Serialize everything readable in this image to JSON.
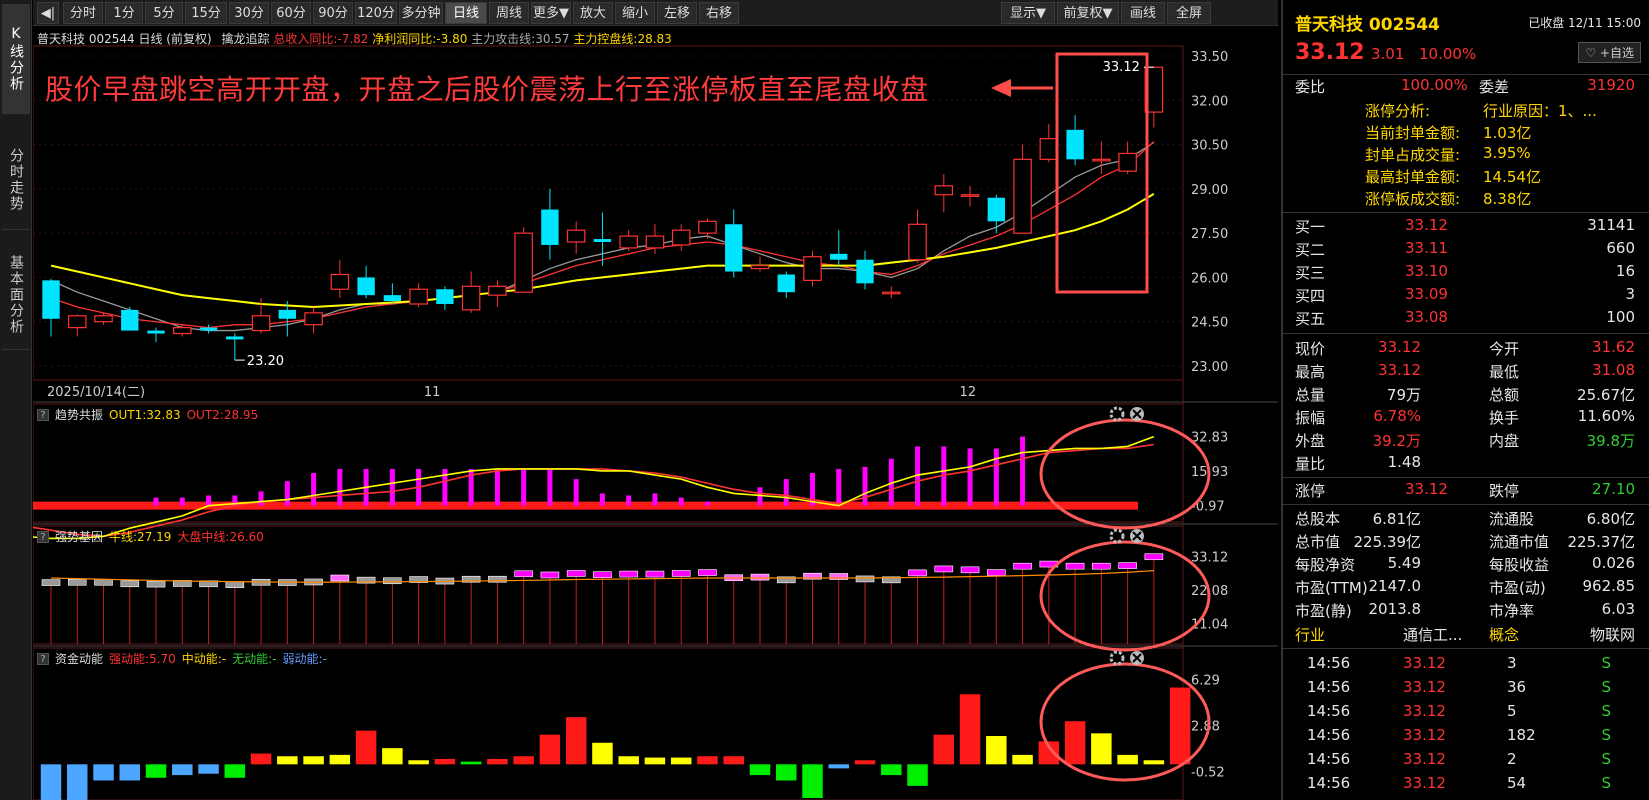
{
  "left_tabs": [
    "K线分析",
    "分时走势",
    "基本面分析"
  ],
  "toolbar": {
    "collapse": "◀|",
    "items": [
      "分时",
      "1分",
      "5分",
      "15分",
      "30分",
      "60分",
      "90分",
      "120分",
      "多分钟",
      "日线",
      "周线",
      "更多▼",
      "放大",
      "缩小",
      "左移",
      "右移"
    ],
    "active": "日线",
    "right": [
      "显示▼",
      "前复权▼",
      "画线",
      "全屏"
    ]
  },
  "chart_info": {
    "stock_tag": "普天科技 002544 日线",
    "fq": "(前复权)",
    "indicator": "擒龙追踪",
    "rev": "总收入同比:-7.82",
    "profit": "净利润同比:-3.80",
    "attack": "主力攻击线:30.57",
    "control": "主力控盘线:28.83"
  },
  "annotation": "股价早盘跳空高开开盘，开盘之后股价震荡上行至涨停板直至尾盘收盘",
  "chart_data": [
    {
      "type": "candlestick",
      "y_ticks": [
        "33.50",
        "32.00",
        "30.50",
        "29.00",
        "27.50",
        "26.00",
        "24.50",
        "23.00"
      ],
      "ylim": [
        23.0,
        33.5
      ],
      "x_labels": [
        "2025/10/14(二)",
        "11",
        "12"
      ],
      "low_label": "23.20",
      "high_label": "33.12",
      "candles": [
        {
          "o": 25.9,
          "c": 24.6,
          "h": 25.95,
          "l": 24.0
        },
        {
          "o": 24.3,
          "c": 24.7,
          "h": 24.75,
          "l": 24.0
        },
        {
          "o": 24.5,
          "c": 24.7,
          "h": 24.8,
          "l": 24.4
        },
        {
          "o": 24.9,
          "c": 24.2,
          "h": 25.0,
          "l": 24.2
        },
        {
          "o": 24.2,
          "c": 24.1,
          "h": 24.3,
          "l": 23.8
        },
        {
          "o": 24.1,
          "c": 24.3,
          "h": 24.4,
          "l": 24.0
        },
        {
          "o": 24.3,
          "c": 24.2,
          "h": 24.4,
          "l": 24.1
        },
        {
          "o": 24.0,
          "c": 23.9,
          "h": 24.1,
          "l": 23.2
        },
        {
          "o": 24.2,
          "c": 24.7,
          "h": 25.3,
          "l": 24.1
        },
        {
          "o": 24.9,
          "c": 24.6,
          "h": 25.2,
          "l": 24.0
        },
        {
          "o": 24.4,
          "c": 24.8,
          "h": 25.0,
          "l": 24.1
        },
        {
          "o": 25.6,
          "c": 26.1,
          "h": 26.6,
          "l": 25.3
        },
        {
          "o": 26.0,
          "c": 25.4,
          "h": 26.4,
          "l": 25.3
        },
        {
          "o": 25.4,
          "c": 25.2,
          "h": 25.8,
          "l": 25.1
        },
        {
          "o": 25.1,
          "c": 25.6,
          "h": 25.8,
          "l": 25.0
        },
        {
          "o": 25.6,
          "c": 25.1,
          "h": 25.7,
          "l": 24.9
        },
        {
          "o": 24.9,
          "c": 25.7,
          "h": 26.2,
          "l": 24.8
        },
        {
          "o": 25.4,
          "c": 25.7,
          "h": 25.9,
          "l": 25.0
        },
        {
          "o": 25.5,
          "c": 27.5,
          "h": 27.7,
          "l": 25.5
        },
        {
          "o": 28.3,
          "c": 27.1,
          "h": 29.0,
          "l": 26.6
        },
        {
          "o": 27.2,
          "c": 27.6,
          "h": 27.9,
          "l": 26.8
        },
        {
          "o": 27.3,
          "c": 27.2,
          "h": 28.2,
          "l": 26.4
        },
        {
          "o": 27.0,
          "c": 27.4,
          "h": 27.6,
          "l": 26.9
        },
        {
          "o": 27.0,
          "c": 27.4,
          "h": 27.8,
          "l": 26.8
        },
        {
          "o": 27.1,
          "c": 27.6,
          "h": 27.8,
          "l": 26.9
        },
        {
          "o": 27.5,
          "c": 27.9,
          "h": 28.0,
          "l": 27.3
        },
        {
          "o": 27.8,
          "c": 26.2,
          "h": 28.3,
          "l": 26.0
        },
        {
          "o": 26.3,
          "c": 26.4,
          "h": 26.7,
          "l": 26.2
        },
        {
          "o": 26.1,
          "c": 25.5,
          "h": 26.2,
          "l": 25.3
        },
        {
          "o": 25.9,
          "c": 26.7,
          "h": 26.9,
          "l": 25.7
        },
        {
          "o": 26.8,
          "c": 26.6,
          "h": 27.6,
          "l": 26.4
        },
        {
          "o": 26.6,
          "c": 25.8,
          "h": 26.9,
          "l": 25.6
        },
        {
          "o": 25.5,
          "c": 25.5,
          "h": 25.7,
          "l": 25.3
        },
        {
          "o": 26.6,
          "c": 27.8,
          "h": 28.3,
          "l": 26.5
        },
        {
          "o": 28.8,
          "c": 29.1,
          "h": 29.5,
          "l": 28.2
        },
        {
          "o": 28.8,
          "c": 28.8,
          "h": 29.1,
          "l": 28.4
        },
        {
          "o": 28.7,
          "c": 27.9,
          "h": 28.8,
          "l": 27.5
        },
        {
          "o": 27.5,
          "c": 30.0,
          "h": 30.5,
          "l": 27.5
        },
        {
          "o": 30.0,
          "c": 30.7,
          "h": 31.2,
          "l": 29.9
        },
        {
          "o": 31.0,
          "c": 30.0,
          "h": 31.5,
          "l": 29.8
        },
        {
          "o": 30.0,
          "c": 30.0,
          "h": 30.6,
          "l": 29.5
        },
        {
          "o": 29.6,
          "c": 30.2,
          "h": 30.6,
          "l": 29.5
        },
        {
          "o": 31.6,
          "c": 33.12,
          "h": 33.12,
          "l": 31.08
        }
      ],
      "ma_red": [
        25.3,
        25.0,
        24.8,
        24.6,
        24.5,
        24.4,
        24.3,
        24.4,
        24.4,
        24.5,
        24.6,
        24.8,
        25.0,
        25.1,
        25.2,
        25.3,
        25.4,
        25.5,
        25.8,
        26.1,
        26.4,
        26.6,
        26.8,
        27.0,
        27.1,
        27.2,
        27.1,
        26.9,
        26.7,
        26.5,
        26.4,
        26.2,
        26.1,
        26.4,
        26.8,
        27.1,
        27.4,
        27.8,
        28.3,
        28.8,
        29.4,
        29.8,
        30.6
      ],
      "ma_yellow": [
        26.4,
        26.2,
        26.0,
        25.8,
        25.6,
        25.4,
        25.3,
        25.2,
        25.1,
        25.05,
        25.0,
        25.05,
        25.1,
        25.15,
        25.2,
        25.3,
        25.4,
        25.5,
        25.6,
        25.75,
        25.9,
        26.0,
        26.1,
        26.2,
        26.3,
        26.4,
        26.4,
        26.4,
        26.4,
        26.4,
        26.4,
        26.4,
        26.5,
        26.6,
        26.7,
        26.85,
        27.0,
        27.2,
        27.4,
        27.6,
        27.9,
        28.3,
        28.83
      ],
      "ma_gray": [
        25.9,
        25.5,
        25.2,
        24.9,
        24.6,
        24.3,
        24.2,
        24.2,
        24.3,
        24.4,
        24.6,
        24.9,
        25.1,
        25.1,
        25.2,
        25.3,
        25.4,
        25.5,
        25.9,
        26.3,
        26.6,
        26.8,
        27.0,
        27.1,
        27.3,
        27.4,
        27.1,
        26.8,
        26.5,
        26.3,
        26.3,
        26.2,
        26.0,
        26.3,
        26.9,
        27.4,
        27.7,
        28.2,
        28.8,
        29.4,
        29.8,
        30.0,
        30.57
      ]
    },
    {
      "type": "bar",
      "name": "趋势共振",
      "labels": {
        "out1": "OUT1:32.83",
        "out2": "OUT2:28.95"
      },
      "y_ticks": [
        "32.83",
        "15.93",
        "-0.97"
      ],
      "ylim": [
        -8,
        38
      ],
      "base": -0.97,
      "bars": [
        0,
        0,
        0,
        0,
        0,
        0,
        0,
        0,
        0,
        0,
        0,
        0,
        0,
        0,
        0,
        3,
        3,
        4,
        4,
        6,
        11,
        15,
        17,
        17,
        17,
        17,
        17,
        17,
        17,
        17,
        17,
        12,
        5,
        4,
        5,
        3,
        1,
        -2,
        8,
        12,
        15,
        17,
        18,
        22,
        28,
        28,
        27,
        27,
        32.83
      ],
      "line_yellow": [
        -10,
        -12,
        -14,
        -16,
        -17,
        -17,
        -16,
        -12,
        -9,
        -6,
        -1,
        0,
        1,
        2,
        4,
        6,
        8,
        10,
        12,
        14,
        16,
        17,
        17,
        17,
        17,
        16,
        16,
        14,
        12,
        8,
        5,
        4,
        3,
        1,
        -1,
        5,
        10,
        14,
        16,
        18,
        22,
        25,
        26,
        27,
        27,
        28,
        32.83
      ],
      "line_red": [
        -3,
        -5,
        -8,
        -11,
        -13,
        -15,
        -16,
        -14,
        -11,
        -8,
        -4,
        -1,
        1,
        2,
        3,
        4,
        5,
        6,
        8,
        11,
        14,
        16,
        17,
        17,
        17,
        17,
        16,
        15,
        13,
        10,
        7,
        5,
        4,
        2,
        0,
        3,
        7,
        11,
        14,
        16,
        19,
        22,
        25,
        26,
        27,
        27,
        28.95
      ]
    },
    {
      "type": "bar",
      "name": "强势基因",
      "labels": {
        "niu": "牛线:27.19",
        "dapan": "大盘中线:26.60"
      },
      "y_ticks": [
        "33.12",
        "22.08",
        "11.04"
      ],
      "ylim": [
        5,
        36
      ]
    },
    {
      "type": "bar",
      "name": "资金动能",
      "labels": {
        "strong": "强动能:5.70",
        "mid": "中动能:-",
        "none": "无动能:-",
        "weak": "弱动能:-"
      },
      "y_ticks": [
        "6.29",
        "2.88",
        "-0.52"
      ],
      "ylim": [
        -2.5,
        7
      ],
      "bars": [
        -3,
        -3,
        -1.2,
        -1.2,
        -1,
        -0.8,
        -0.7,
        -1,
        0.8,
        0.6,
        0.6,
        0.7,
        2.5,
        1.2,
        0.3,
        0.4,
        0.2,
        0.4,
        0.6,
        2.2,
        3.5,
        1.6,
        0.6,
        0.5,
        0.5,
        0.6,
        0.6,
        -0.8,
        -1.2,
        -2.5,
        -0.3,
        0.3,
        -0.8,
        -1.6,
        2.2,
        5.2,
        2.1,
        0.7,
        1.7,
        3.2,
        2.3,
        0.7,
        0.3,
        5.7
      ],
      "bar_colors": [
        "blue",
        "blue",
        "blue",
        "blue",
        "green",
        "blue",
        "blue",
        "green",
        "red",
        "yellow",
        "yellow",
        "yellow",
        "red",
        "yellow",
        "yellow",
        "red",
        "green",
        "red",
        "red",
        "red",
        "red",
        "yellow",
        "yellow",
        "yellow",
        "yellow",
        "red",
        "red",
        "green",
        "green",
        "green",
        "blue",
        "red",
        "green",
        "green",
        "red",
        "red",
        "yellow",
        "yellow",
        "red",
        "red",
        "yellow",
        "yellow",
        "yellow",
        "red"
      ]
    }
  ],
  "colors": {
    "up": "#ff3333",
    "down": "#00e5ff",
    "magenta": "#ff00ff",
    "yellow": "#ffff00",
    "gray": "#999999",
    "grid": "#3a1010",
    "annot": "#ff4d4d"
  },
  "right": {
    "title": "普天科技 002544",
    "status": "已收盘 12/11 15:00",
    "price": "33.12",
    "change": "3.01",
    "pct": "10.00%",
    "add": "♡ +自选",
    "weibi": {
      "l1": "委比",
      "v1": "100.00%",
      "l2": "委差",
      "v2": "31920"
    },
    "zt": [
      {
        "k": "涨停分析:",
        "v": "行业原因：1、..."
      },
      {
        "k": "当前封单金额:",
        "v": "1.03亿"
      },
      {
        "k": "封单占成交量:",
        "v": "3.95%"
      },
      {
        "k": "最高封单金额:",
        "v": "14.54亿"
      },
      {
        "k": "涨停板成交额:",
        "v": "8.38亿"
      }
    ],
    "buy": [
      {
        "n": "买一",
        "p": "33.12",
        "v": "31141"
      },
      {
        "n": "买二",
        "p": "33.11",
        "v": "660"
      },
      {
        "n": "买三",
        "p": "33.10",
        "v": "16"
      },
      {
        "n": "买四",
        "p": "33.09",
        "v": "3"
      },
      {
        "n": "买五",
        "p": "33.08",
        "v": "100"
      }
    ],
    "q": [
      {
        "a": "现价",
        "b": "33.12",
        "c": "今开",
        "d": "31.62",
        "bc": "red",
        "dc": "red"
      },
      {
        "a": "最高",
        "b": "33.12",
        "c": "最低",
        "d": "31.08",
        "bc": "red",
        "dc": "red"
      },
      {
        "a": "总量",
        "b": "79万",
        "c": "总额",
        "d": "25.67亿",
        "bc": "white",
        "dc": "white"
      },
      {
        "a": "振幅",
        "b": "6.78%",
        "c": "换手",
        "d": "11.60%",
        "bc": "red",
        "dc": "white"
      },
      {
        "a": "外盘",
        "b": "39.2万",
        "c": "内盘",
        "d": "39.8万",
        "bc": "red",
        "dc": "green"
      },
      {
        "a": "量比",
        "b": "1.48",
        "c": "",
        "d": "",
        "bc": "white",
        "dc": "white"
      }
    ],
    "limit": {
      "a": "涨停",
      "b": "33.12",
      "c": "跌停",
      "d": "27.10"
    },
    "fund": [
      {
        "a": "总股本",
        "b": "6.81亿",
        "c": "流通股",
        "d": "6.80亿"
      },
      {
        "a": "总市值",
        "b": "225.39亿",
        "c": "流通市值",
        "d": "225.37亿"
      },
      {
        "a": "每股净资",
        "b": "5.49",
        "c": "每股收益",
        "d": "0.026"
      },
      {
        "a": "市盈(TTM)",
        "b": "2147.0",
        "c": "市盈(动)",
        "d": "962.85"
      },
      {
        "a": "市盈(静)",
        "b": "2013.8",
        "c": "市净率",
        "d": "6.03"
      }
    ],
    "industry": {
      "a": "行业",
      "b": "通信工...",
      "c": "概念",
      "d": "物联网"
    },
    "ticks": [
      {
        "t": "14:56",
        "p": "33.12",
        "v": "3",
        "s": "S"
      },
      {
        "t": "14:56",
        "p": "33.12",
        "v": "36",
        "s": "S"
      },
      {
        "t": "14:56",
        "p": "33.12",
        "v": "5",
        "s": "S"
      },
      {
        "t": "14:56",
        "p": "33.12",
        "v": "182",
        "s": "S"
      },
      {
        "t": "14:56",
        "p": "33.12",
        "v": "2",
        "s": "S"
      },
      {
        "t": "14:56",
        "p": "33.12",
        "v": "54",
        "s": "S"
      }
    ]
  }
}
